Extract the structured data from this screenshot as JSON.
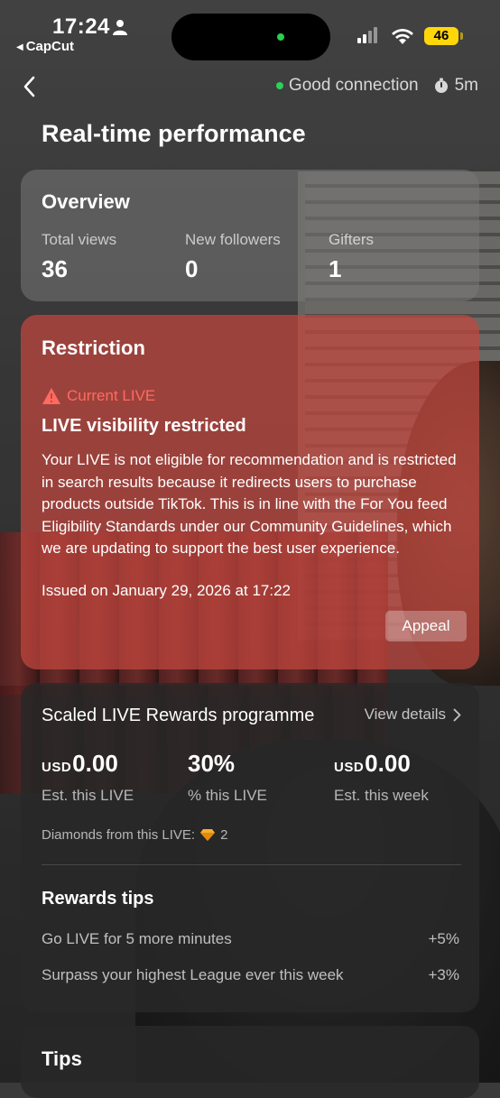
{
  "status_bar": {
    "time": "17:24",
    "back_app": "CapCut",
    "battery": "46"
  },
  "header": {
    "connection": "Good connection",
    "timer": "5m",
    "title": "Real-time performance"
  },
  "overview": {
    "title": "Overview",
    "stats": [
      {
        "label": "Total views",
        "value": "36"
      },
      {
        "label": "New followers",
        "value": "0"
      },
      {
        "label": "Gifters",
        "value": "1"
      }
    ]
  },
  "restriction": {
    "title": "Restriction",
    "tag": "Current LIVE",
    "heading": "LIVE visibility restricted",
    "body": "Your LIVE is not eligible for recommendation and is restricted in search results because it redirects users to purchase products outside TikTok. This is in line with the For You feed Eligibility Standards under our Community Guidelines, which we are updating to support the best user experience.",
    "issued": "Issued on January 29, 2026 at 17:22",
    "appeal_label": "Appeal"
  },
  "rewards": {
    "title": "Scaled LIVE Rewards programme",
    "view_details": "View details",
    "metrics": [
      {
        "currency": "USD",
        "value": "0.00",
        "label": "Est. this LIVE"
      },
      {
        "currency": "",
        "value": "30%",
        "label": "% this LIVE"
      },
      {
        "currency": "USD",
        "value": "0.00",
        "label": "Est. this week"
      }
    ],
    "diamonds_label": "Diamonds from this LIVE:",
    "diamonds_value": "2",
    "tips_title": "Rewards tips",
    "tips": [
      {
        "text": "Go LIVE for 5 more minutes",
        "bonus": "+5%"
      },
      {
        "text": "Surpass your highest League ever this week",
        "bonus": "+3%"
      }
    ]
  },
  "tips_card": {
    "title": "Tips"
  },
  "colors": {
    "restriction_bg": "#c4463e",
    "warning": "#ff6b60",
    "connection_dot": "#2fcf5a",
    "battery": "#ffd60a"
  }
}
